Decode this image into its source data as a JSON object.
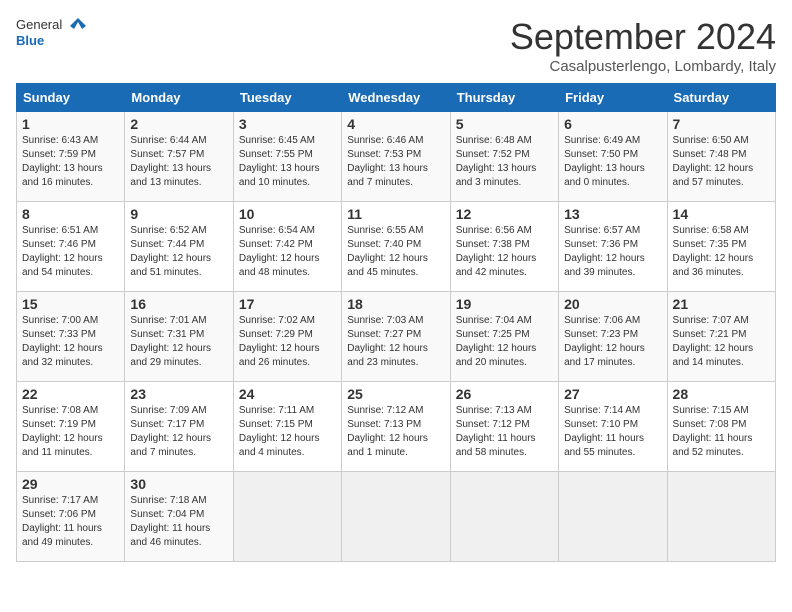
{
  "header": {
    "logo_general": "General",
    "logo_blue": "Blue",
    "title": "September 2024",
    "location": "Casalpusterlengo, Lombardy, Italy"
  },
  "days_of_week": [
    "Sunday",
    "Monday",
    "Tuesday",
    "Wednesday",
    "Thursday",
    "Friday",
    "Saturday"
  ],
  "weeks": [
    [
      {
        "day": "1",
        "sunrise": "6:43 AM",
        "sunset": "7:59 PM",
        "daylight": "13 hours and 16 minutes."
      },
      {
        "day": "2",
        "sunrise": "6:44 AM",
        "sunset": "7:57 PM",
        "daylight": "13 hours and 13 minutes."
      },
      {
        "day": "3",
        "sunrise": "6:45 AM",
        "sunset": "7:55 PM",
        "daylight": "13 hours and 10 minutes."
      },
      {
        "day": "4",
        "sunrise": "6:46 AM",
        "sunset": "7:53 PM",
        "daylight": "13 hours and 7 minutes."
      },
      {
        "day": "5",
        "sunrise": "6:48 AM",
        "sunset": "7:52 PM",
        "daylight": "13 hours and 3 minutes."
      },
      {
        "day": "6",
        "sunrise": "6:49 AM",
        "sunset": "7:50 PM",
        "daylight": "13 hours and 0 minutes."
      },
      {
        "day": "7",
        "sunrise": "6:50 AM",
        "sunset": "7:48 PM",
        "daylight": "12 hours and 57 minutes."
      }
    ],
    [
      {
        "day": "8",
        "sunrise": "6:51 AM",
        "sunset": "7:46 PM",
        "daylight": "12 hours and 54 minutes."
      },
      {
        "day": "9",
        "sunrise": "6:52 AM",
        "sunset": "7:44 PM",
        "daylight": "12 hours and 51 minutes."
      },
      {
        "day": "10",
        "sunrise": "6:54 AM",
        "sunset": "7:42 PM",
        "daylight": "12 hours and 48 minutes."
      },
      {
        "day": "11",
        "sunrise": "6:55 AM",
        "sunset": "7:40 PM",
        "daylight": "12 hours and 45 minutes."
      },
      {
        "day": "12",
        "sunrise": "6:56 AM",
        "sunset": "7:38 PM",
        "daylight": "12 hours and 42 minutes."
      },
      {
        "day": "13",
        "sunrise": "6:57 AM",
        "sunset": "7:36 PM",
        "daylight": "12 hours and 39 minutes."
      },
      {
        "day": "14",
        "sunrise": "6:58 AM",
        "sunset": "7:35 PM",
        "daylight": "12 hours and 36 minutes."
      }
    ],
    [
      {
        "day": "15",
        "sunrise": "7:00 AM",
        "sunset": "7:33 PM",
        "daylight": "12 hours and 32 minutes."
      },
      {
        "day": "16",
        "sunrise": "7:01 AM",
        "sunset": "7:31 PM",
        "daylight": "12 hours and 29 minutes."
      },
      {
        "day": "17",
        "sunrise": "7:02 AM",
        "sunset": "7:29 PM",
        "daylight": "12 hours and 26 minutes."
      },
      {
        "day": "18",
        "sunrise": "7:03 AM",
        "sunset": "7:27 PM",
        "daylight": "12 hours and 23 minutes."
      },
      {
        "day": "19",
        "sunrise": "7:04 AM",
        "sunset": "7:25 PM",
        "daylight": "12 hours and 20 minutes."
      },
      {
        "day": "20",
        "sunrise": "7:06 AM",
        "sunset": "7:23 PM",
        "daylight": "12 hours and 17 minutes."
      },
      {
        "day": "21",
        "sunrise": "7:07 AM",
        "sunset": "7:21 PM",
        "daylight": "12 hours and 14 minutes."
      }
    ],
    [
      {
        "day": "22",
        "sunrise": "7:08 AM",
        "sunset": "7:19 PM",
        "daylight": "12 hours and 11 minutes."
      },
      {
        "day": "23",
        "sunrise": "7:09 AM",
        "sunset": "7:17 PM",
        "daylight": "12 hours and 7 minutes."
      },
      {
        "day": "24",
        "sunrise": "7:11 AM",
        "sunset": "7:15 PM",
        "daylight": "12 hours and 4 minutes."
      },
      {
        "day": "25",
        "sunrise": "7:12 AM",
        "sunset": "7:13 PM",
        "daylight": "12 hours and 1 minute."
      },
      {
        "day": "26",
        "sunrise": "7:13 AM",
        "sunset": "7:12 PM",
        "daylight": "11 hours and 58 minutes."
      },
      {
        "day": "27",
        "sunrise": "7:14 AM",
        "sunset": "7:10 PM",
        "daylight": "11 hours and 55 minutes."
      },
      {
        "day": "28",
        "sunrise": "7:15 AM",
        "sunset": "7:08 PM",
        "daylight": "11 hours and 52 minutes."
      }
    ],
    [
      {
        "day": "29",
        "sunrise": "7:17 AM",
        "sunset": "7:06 PM",
        "daylight": "11 hours and 49 minutes."
      },
      {
        "day": "30",
        "sunrise": "7:18 AM",
        "sunset": "7:04 PM",
        "daylight": "11 hours and 46 minutes."
      },
      null,
      null,
      null,
      null,
      null
    ]
  ]
}
